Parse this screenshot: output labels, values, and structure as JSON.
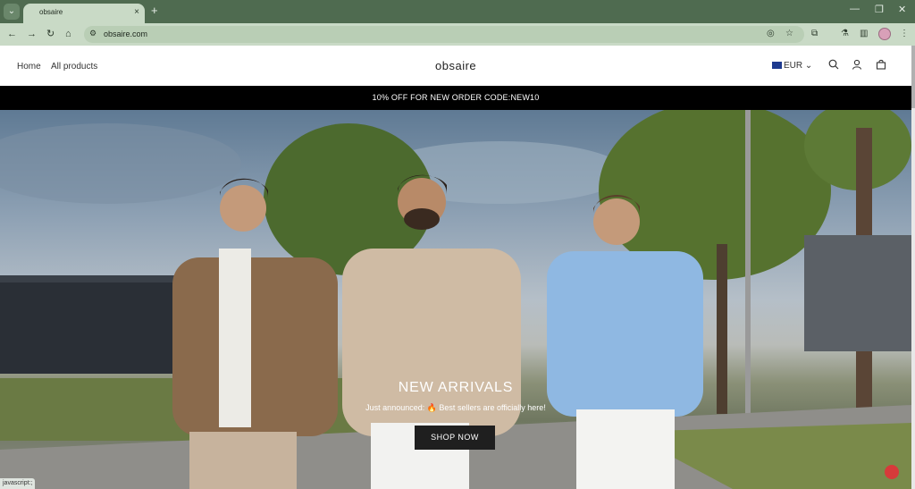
{
  "browser": {
    "tab_title": "obsaire",
    "url": "obsaire.com",
    "status_text": "javascript:;",
    "new_tab_glyph": "+",
    "close_glyph": "×"
  },
  "site": {
    "nav": [
      "Home",
      "All products"
    ],
    "logo": "obsaire",
    "currency": "EUR",
    "announcement": "10% OFF FOR NEW ORDER CODE:NEW10"
  },
  "hero": {
    "title": "NEW ARRIVALS",
    "subtitle": "Just announced: 🔥 Best sellers are officially here!",
    "button": "SHOP NOW"
  },
  "icons": {
    "search": "search-icon",
    "account": "account-icon",
    "cart": "cart-icon"
  },
  "colors": {
    "chrome_dark": "#4f6b50",
    "chrome_light": "#c9dac6",
    "announce_bg": "#000000",
    "button_bg": "#1f1f1f"
  }
}
